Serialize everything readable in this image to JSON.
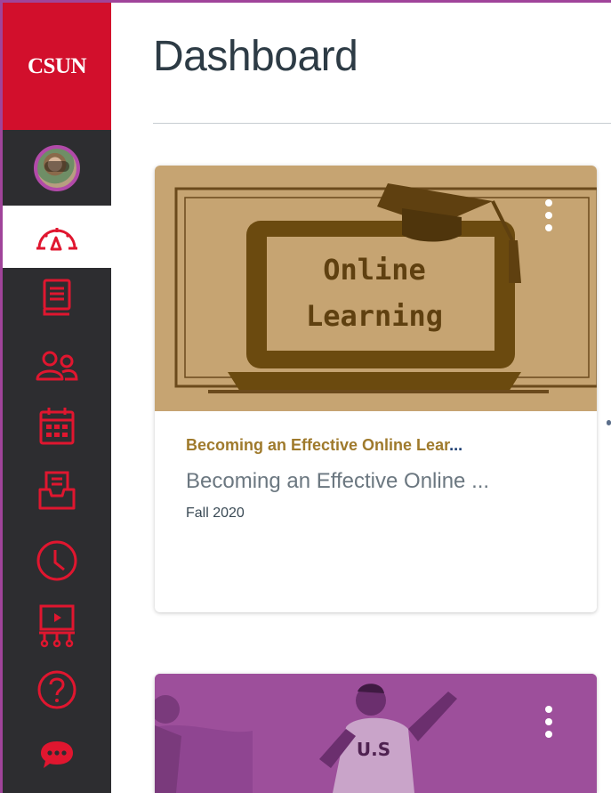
{
  "brand": {
    "label": "CSUN",
    "color": "#d20f2c"
  },
  "nav": {
    "items": [
      {
        "name": "account",
        "icon": "user-avatar"
      },
      {
        "name": "dashboard",
        "icon": "speedometer-icon",
        "active": true
      },
      {
        "name": "courses",
        "icon": "book-icon"
      },
      {
        "name": "groups",
        "icon": "people-icon"
      },
      {
        "name": "calendar",
        "icon": "calendar-icon"
      },
      {
        "name": "inbox",
        "icon": "inbox-icon"
      },
      {
        "name": "history",
        "icon": "clock-icon"
      },
      {
        "name": "studio",
        "icon": "presentation-icon"
      },
      {
        "name": "help",
        "icon": "help-icon"
      },
      {
        "name": "chat",
        "icon": "chat-bubble-icon"
      }
    ],
    "accent": "#e0162f",
    "background": "#2d2d30"
  },
  "main": {
    "title": "Dashboard",
    "cards": [
      {
        "hero_text_line1": "Online",
        "hero_text_line2": "Learning",
        "hero_color": "#c6a472",
        "course_code": "Becoming an Effective Online Lear",
        "course_code_ellipsis": "...",
        "course_name": "Becoming an Effective Online ...",
        "term": "Fall 2020",
        "code_color": "#9f7a2c"
      },
      {
        "hero_color": "#9d4f9b",
        "hero_jersey_text": "U.S"
      }
    ]
  }
}
